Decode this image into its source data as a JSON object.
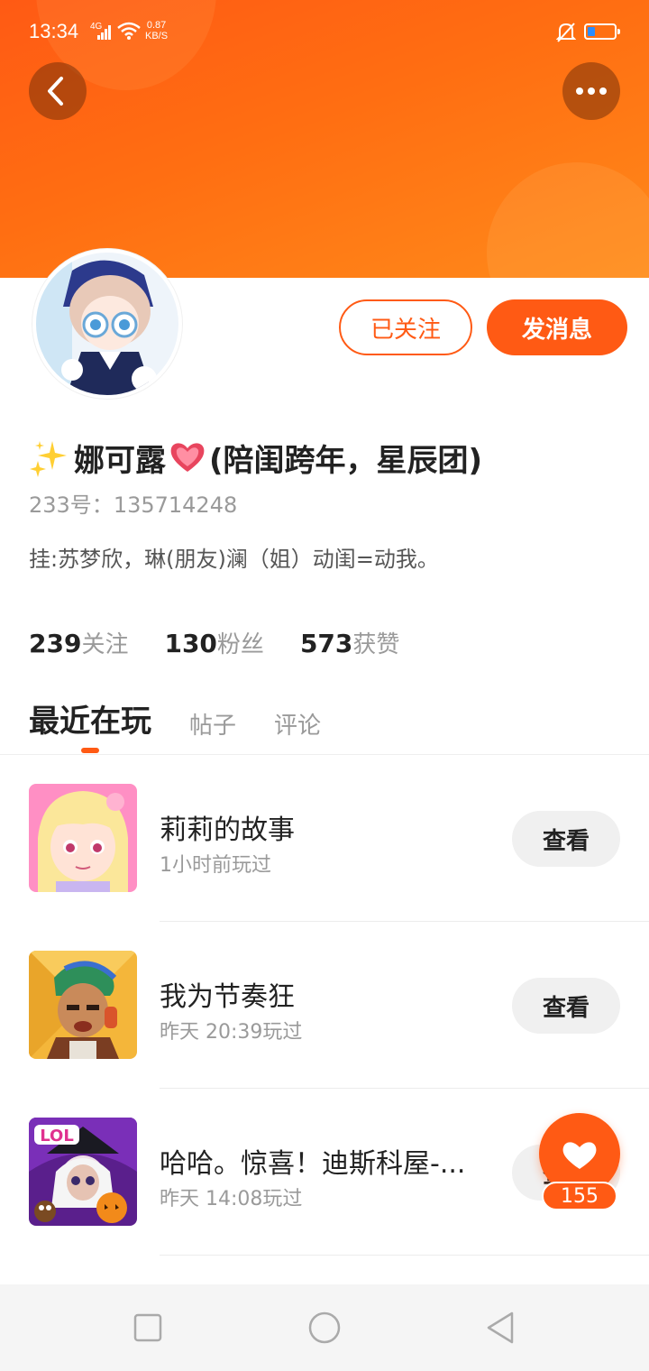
{
  "status_bar": {
    "time": "13:34",
    "network": "4G",
    "speed_value": "0.87",
    "speed_unit": "KB/S"
  },
  "profile": {
    "name": "娜可露",
    "name_suffix": "(陪闺跨年，星辰团)",
    "id_label": "233号：",
    "id_value": "135714248",
    "bio": "挂:苏梦欣，琳(朋友)澜（姐）动闺=动我。"
  },
  "actions": {
    "follow_label": "已关注",
    "message_label": "发消息"
  },
  "stats": [
    {
      "num": "239",
      "label": "关注"
    },
    {
      "num": "130",
      "label": "粉丝"
    },
    {
      "num": "573",
      "label": "获赞"
    }
  ],
  "tabs": [
    {
      "label": "最近在玩",
      "active": true
    },
    {
      "label": "帖子",
      "active": false
    },
    {
      "label": "评论",
      "active": false
    }
  ],
  "games": [
    {
      "title": "莉莉的故事",
      "time": "1小时前玩过",
      "button": "查看"
    },
    {
      "title": "我为节奏狂",
      "time": "昨天 20:39玩过",
      "button": "查看"
    },
    {
      "title": "哈哈。惊喜！迪斯科屋-...",
      "time": "昨天 14:08玩过",
      "button": "查看"
    }
  ],
  "game3_icon_text": "LOL",
  "like": {
    "count": "155"
  },
  "colors": {
    "accent": "#ff5a14",
    "banner_end": "#ff8a1a",
    "muted": "#9a9a9a"
  },
  "icons": [
    "back-icon",
    "more-icon",
    "sparkle-icon",
    "heart-icon",
    "like-heart-icon",
    "nav-square-icon",
    "nav-circle-icon",
    "nav-back-triangle-icon"
  ]
}
